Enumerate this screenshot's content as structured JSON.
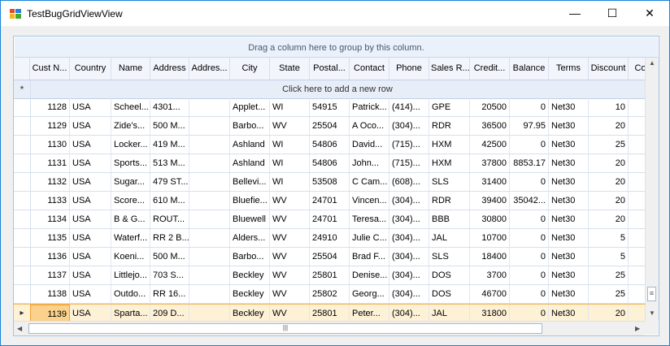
{
  "window": {
    "title": "TestBugGridViewView",
    "minimize_glyph": "—",
    "maximize_glyph": "☐",
    "close_glyph": "✕"
  },
  "grid": {
    "group_panel_text": "Drag a column here to group by this column.",
    "new_row_text": "Click here to add a new row",
    "new_row_indicator": "*",
    "current_row_indicator": "▸",
    "columns": [
      "Cust N...",
      "Country",
      "Name",
      "Address",
      "Addres...",
      "City",
      "State",
      "Postal...",
      "Contact",
      "Phone",
      "Sales R...",
      "Credit...",
      "Balance",
      "Terms",
      "Discount",
      "Co"
    ],
    "rows": [
      [
        "1128",
        "USA",
        "Scheel...",
        "4301...",
        "",
        "Applet...",
        "WI",
        "54915",
        "Patrick...",
        "(414)...",
        "GPE",
        "20500",
        "0",
        "Net30",
        "10"
      ],
      [
        "1129",
        "USA",
        "Zide's...",
        "500 M...",
        "",
        "Barbo...",
        "WV",
        "25504",
        "A Oco...",
        "(304)...",
        "RDR",
        "36500",
        "97.95",
        "Net30",
        "20"
      ],
      [
        "1130",
        "USA",
        "Locker...",
        "419 M...",
        "",
        "Ashland",
        "WI",
        "54806",
        "David...",
        "(715)...",
        "HXM",
        "42500",
        "0",
        "Net30",
        "25"
      ],
      [
        "1131",
        "USA",
        "Sports...",
        "513 M...",
        "",
        "Ashland",
        "WI",
        "54806",
        "John...",
        "(715)...",
        "HXM",
        "37800",
        "8853.17",
        "Net30",
        "20"
      ],
      [
        "1132",
        "USA",
        "Sugar...",
        "479 ST...",
        "",
        "Bellevi...",
        "WI",
        "53508",
        "C Cam...",
        "(608)...",
        "SLS",
        "31400",
        "0",
        "Net30",
        "20"
      ],
      [
        "1133",
        "USA",
        "Score...",
        "610 M...",
        "",
        "Bluefie...",
        "WV",
        "24701",
        "Vincen...",
        "(304)...",
        "RDR",
        "39400",
        "35042...",
        "Net30",
        "20"
      ],
      [
        "1134",
        "USA",
        "B & G...",
        "ROUT...",
        "",
        "Bluewell",
        "WV",
        "24701",
        "Teresa...",
        "(304)...",
        "BBB",
        "30800",
        "0",
        "Net30",
        "20"
      ],
      [
        "1135",
        "USA",
        "Waterf...",
        "RR 2 B...",
        "",
        "Alders...",
        "WV",
        "24910",
        "Julie C...",
        "(304)...",
        "JAL",
        "10700",
        "0",
        "Net30",
        "5"
      ],
      [
        "1136",
        "USA",
        "Koeni...",
        "500 M...",
        "",
        "Barbo...",
        "WV",
        "25504",
        "Brad F...",
        "(304)...",
        "SLS",
        "18400",
        "0",
        "Net30",
        "5"
      ],
      [
        "1137",
        "USA",
        "Littlejo...",
        "703 S...",
        "",
        "Beckley",
        "WV",
        "25801",
        "Denise...",
        "(304)...",
        "DOS",
        "3700",
        "0",
        "Net30",
        "25"
      ],
      [
        "1138",
        "USA",
        "Outdo...",
        "RR 16...",
        "",
        "Beckley",
        "WV",
        "25802",
        "Georg...",
        "(304)...",
        "DOS",
        "46700",
        "0",
        "Net30",
        "25"
      ],
      [
        "1139",
        "USA",
        "Sparta...",
        "209 D...",
        "",
        "Beckley",
        "WV",
        "25801",
        "Peter...",
        "(304)...",
        "JAL",
        "31800",
        "0",
        "Net30",
        "20"
      ]
    ],
    "selected_row": 11
  },
  "scrollbars": {
    "up_glyph": "▲",
    "down_glyph": "▼",
    "left_glyph": "◀",
    "right_glyph": "▶",
    "vthumb_grip": "≡",
    "hthumb_grip": "|||"
  },
  "icons": {
    "app": "app-icon"
  }
}
